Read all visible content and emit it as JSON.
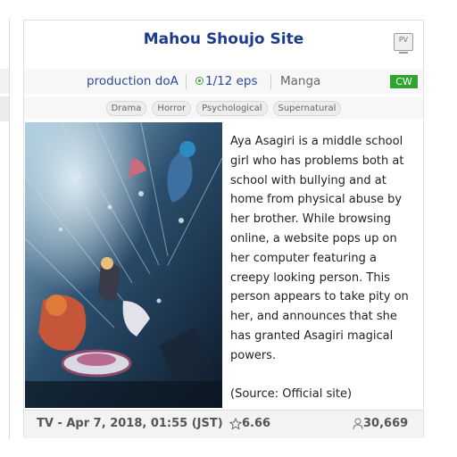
{
  "card": {
    "title": "Mahou Shoujo Site",
    "pv_label": "PV",
    "studio": "production doA",
    "episodes": "1/12 eps",
    "source": "Manga",
    "badge": "CW",
    "genres": [
      "Drama",
      "Horror",
      "Psychological",
      "Supernatural"
    ],
    "synopsis": "Aya Asagiri is a middle school girl who has problems both at school with bullying and at home from physical abuse by her brother. While browsing online, a website pops up on her computer featuring a creepy looking person. This person appears to take pity on her, and announces that she has granted Asagiri magical powers.\n\n(Source: Official site)",
    "air_info": "TV - Apr 7, 2018, 01:55 (JST)",
    "score": "6.66",
    "members": "30,669"
  },
  "colors": {
    "title": "#1d3b8c",
    "badge": "#2ea52e",
    "eps_icon": "#45a045"
  },
  "icons": {
    "pv": "video-icon",
    "eps": "airing-dot-icon",
    "score": "star-icon",
    "members": "user-icon"
  }
}
